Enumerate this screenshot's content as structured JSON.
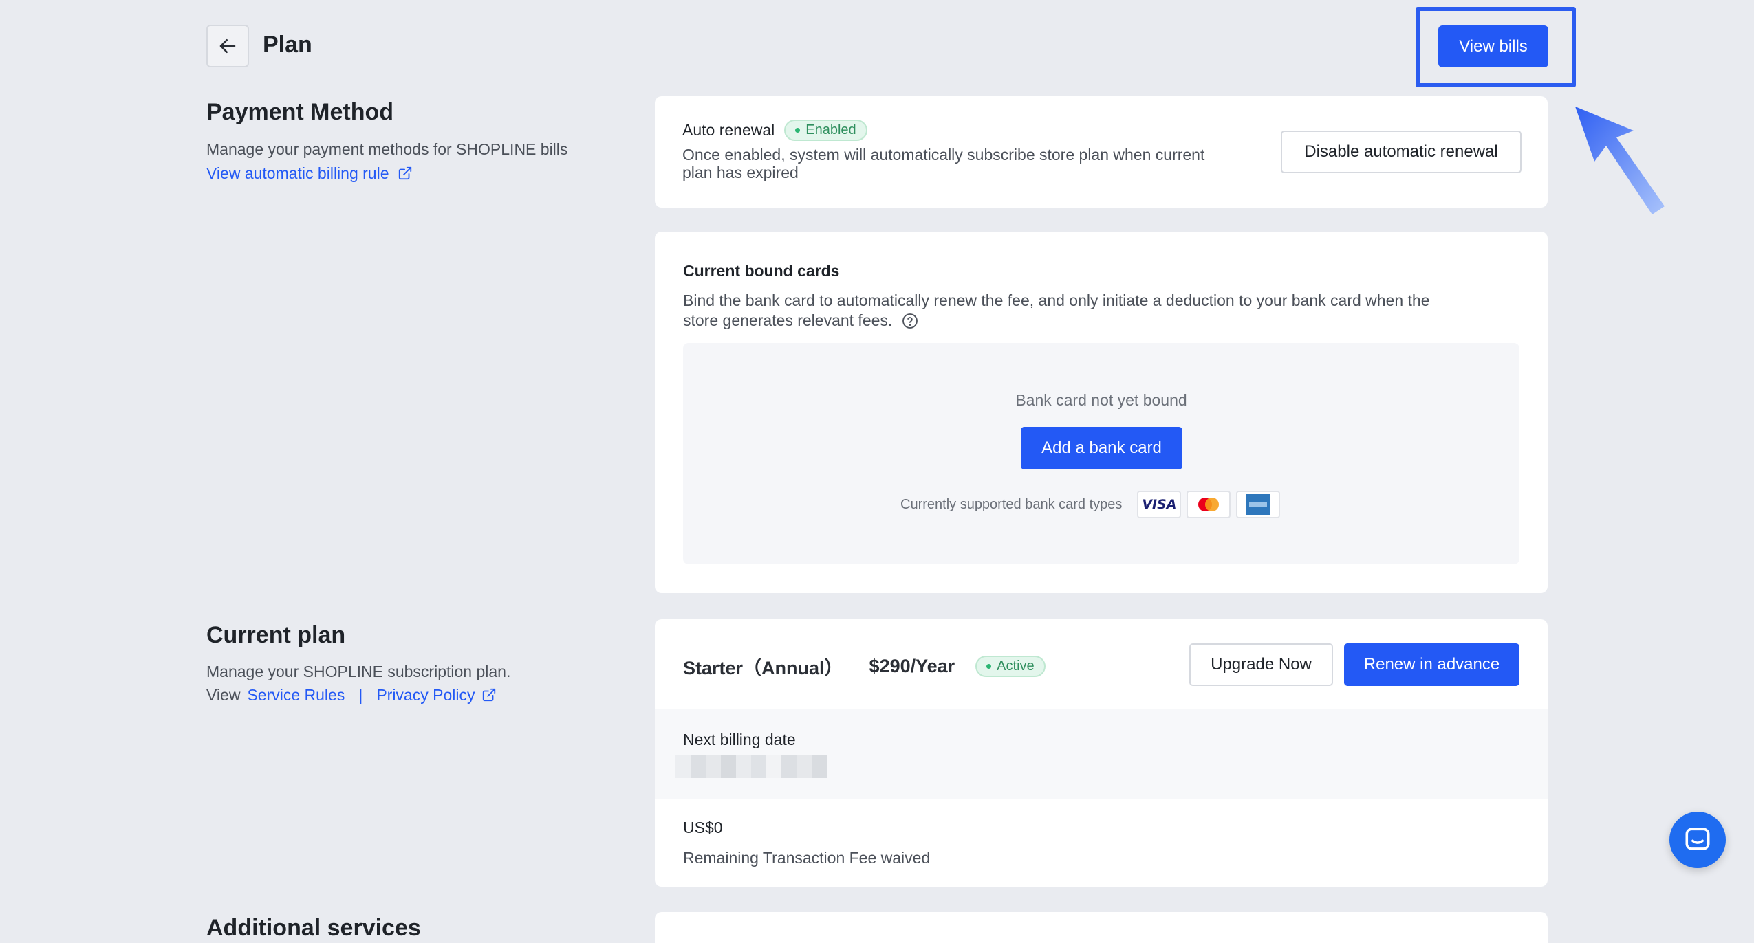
{
  "header": {
    "title": "Plan",
    "view_bills_label": "View bills"
  },
  "payment_method": {
    "title": "Payment Method",
    "description": "Manage your payment methods for SHOPLINE bills",
    "billing_rule_link": "View automatic billing rule"
  },
  "auto_renewal": {
    "label": "Auto renewal",
    "badge": "Enabled",
    "description_line1": "Once enabled, system will automatically subscribe store plan when current",
    "description_line2": "plan has expired",
    "disable_label": "Disable automatic renewal"
  },
  "bound_cards": {
    "title": "Current bound cards",
    "description_line1": "Bind the bank card to automatically renew the fee, and only initiate a deduction to your bank card when the",
    "description_line2": "store generates relevant fees.",
    "empty_text": "Bank card not yet bound",
    "add_label": "Add a bank card",
    "supported_text": "Currently supported bank card types",
    "card_types": [
      "visa-icon",
      "mastercard-icon",
      "amex-icon"
    ],
    "visa_text": "VISA"
  },
  "current_plan": {
    "title": "Current plan",
    "description": "Manage your SHOPLINE subscription plan.",
    "view_prefix": "View",
    "service_rules": "Service Rules",
    "separator": "|",
    "privacy_policy": "Privacy Policy",
    "plan_name": "Starter（Annual）",
    "price": "$290/Year",
    "badge": "Active",
    "upgrade_label": "Upgrade Now",
    "renew_label": "Renew in advance",
    "next_billing_label": "Next billing date",
    "fee_amount": "US$0",
    "fee_description": "Remaining Transaction Fee waived"
  },
  "additional_services": {
    "title": "Additional services"
  },
  "colors": {
    "primary": "#2359f5",
    "background": "#e9ebf0",
    "success": "#2bb673"
  }
}
